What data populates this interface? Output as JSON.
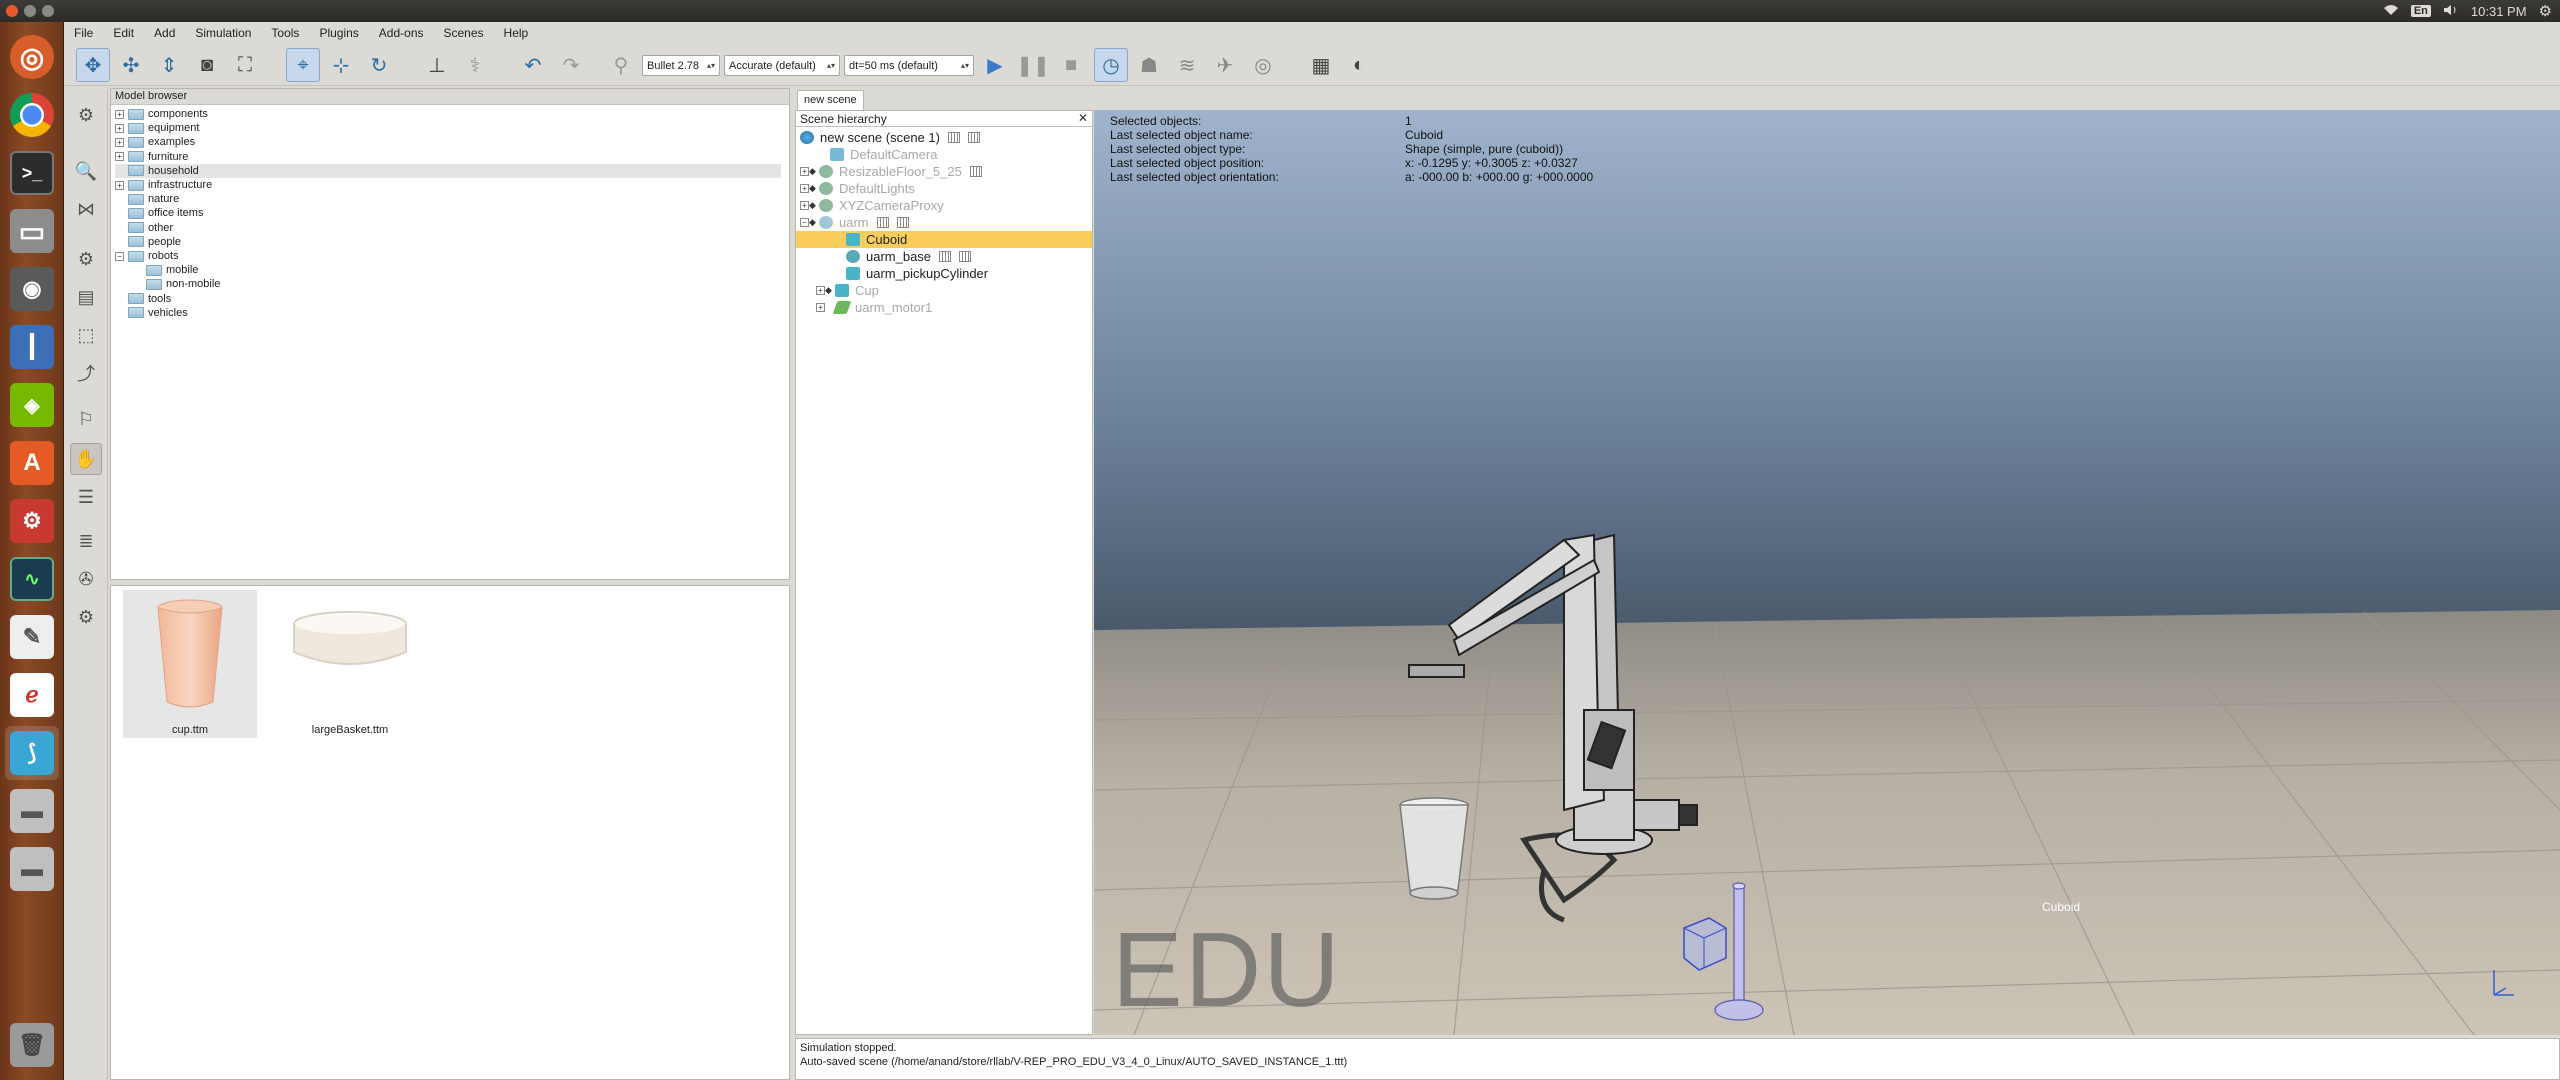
{
  "system": {
    "language": "En",
    "time": "10:31 PM"
  },
  "menu": [
    "File",
    "Edit",
    "Add",
    "Simulation",
    "Tools",
    "Plugins",
    "Add-ons",
    "Scenes",
    "Help"
  ],
  "toolbar": {
    "physics_engine": "Bullet 2.78",
    "accuracy": "Accurate (default)",
    "timestep": "dt=50 ms (default)"
  },
  "model_browser": {
    "title": "Model browser",
    "folders": [
      {
        "label": "components",
        "expand": "+"
      },
      {
        "label": "equipment",
        "expand": "+"
      },
      {
        "label": "examples",
        "expand": "+"
      },
      {
        "label": "furniture",
        "expand": "+"
      },
      {
        "label": "household",
        "expand": ""
      },
      {
        "label": "infrastructure",
        "expand": "+"
      },
      {
        "label": "nature",
        "expand": ""
      },
      {
        "label": "office items",
        "expand": ""
      },
      {
        "label": "other",
        "expand": ""
      },
      {
        "label": "people",
        "expand": ""
      },
      {
        "label": "robots",
        "expand": "−"
      },
      {
        "label": "mobile",
        "expand": ""
      },
      {
        "label": "non-mobile",
        "expand": ""
      },
      {
        "label": "tools",
        "expand": ""
      },
      {
        "label": "vehicles",
        "expand": ""
      }
    ],
    "thumbnails": [
      {
        "label": "cup.ttm"
      },
      {
        "label": "largeBasket.ttm"
      }
    ]
  },
  "scene_tab": "new scene",
  "hierarchy": {
    "title": "Scene hierarchy",
    "close": "✕",
    "items": [
      {
        "label": "new scene (scene 1)"
      },
      {
        "label": "DefaultCamera"
      },
      {
        "label": "ResizableFloor_5_25"
      },
      {
        "label": "DefaultLights"
      },
      {
        "label": "XYZCameraProxy"
      },
      {
        "label": "uarm"
      },
      {
        "label": "Cuboid"
      },
      {
        "label": "uarm_base"
      },
      {
        "label": "uarm_pickupCylinder"
      },
      {
        "label": "Cup"
      },
      {
        "label": "uarm_motor1"
      }
    ]
  },
  "viewport": {
    "info": [
      {
        "k": "Selected objects:",
        "v": "1"
      },
      {
        "k": "Last selected object name:",
        "v": "Cuboid"
      },
      {
        "k": "Last selected object type:",
        "v": "Shape (simple, pure (cuboid))"
      },
      {
        "k": "Last selected object position:",
        "v": "x: -0.1295    y: +0.3005    z: +0.0327"
      },
      {
        "k": "Last selected object orientation:",
        "v": "a: -000.00    b: +000.00    g: +000.0000"
      }
    ],
    "watermark": "EDU",
    "object_label": "Cuboid"
  },
  "status": {
    "line1": "Simulation stopped.",
    "line2": "Auto-saved scene (/home/anand/store/rllab/V-REP_PRO_EDU_V3_4_0_Linux/AUTO_SAVED_INSTANCE_1.ttt)"
  }
}
